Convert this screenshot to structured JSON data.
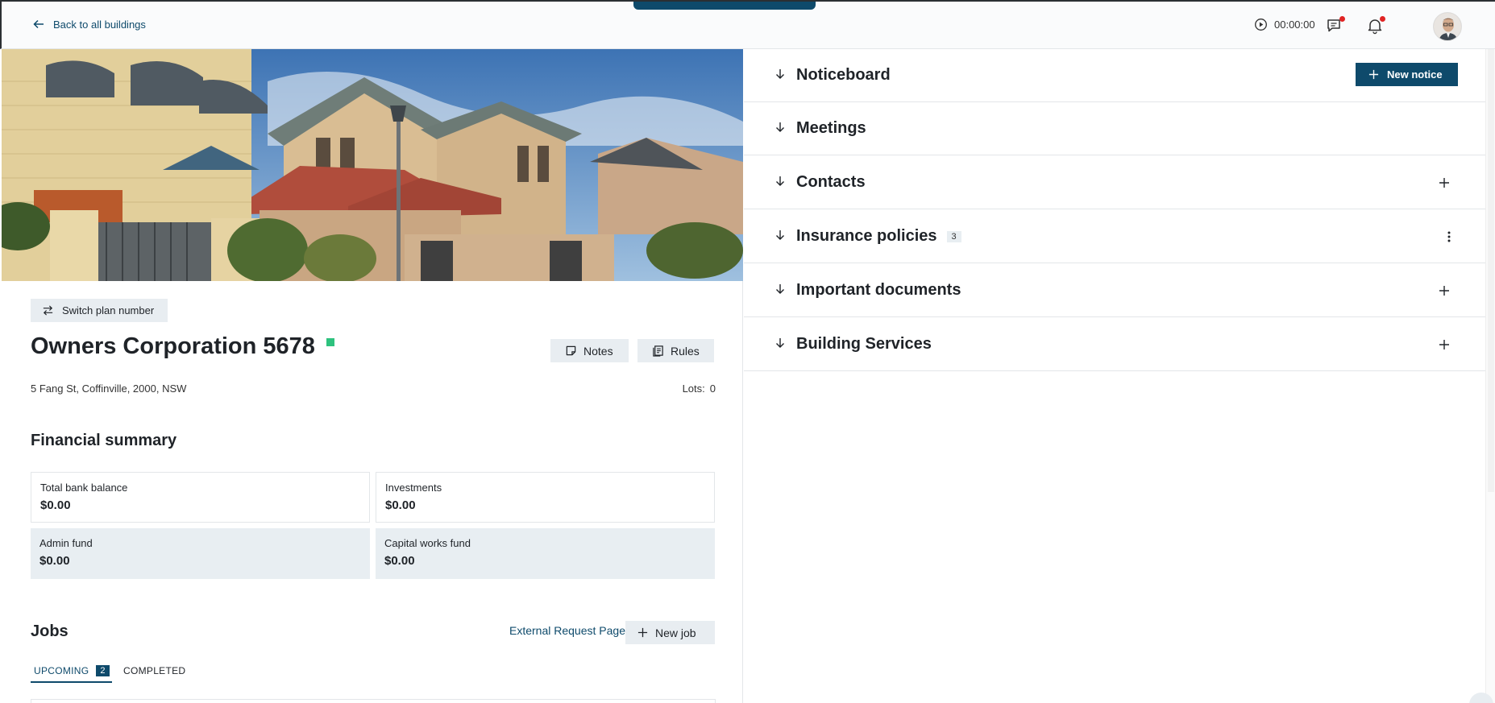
{
  "header": {
    "back_label": "Back to all buildings",
    "timer": "00:00:00"
  },
  "building": {
    "switch_label": "Switch plan number",
    "title": "Owners Corporation 5678",
    "notes_label": "Notes",
    "rules_label": "Rules",
    "address": "5 Fang St, Coffinville, 2000, NSW",
    "lots_label": "Lots:",
    "lots_value": "0"
  },
  "financial": {
    "title": "Financial summary",
    "cards": [
      {
        "label": "Total bank balance",
        "value": "$0.00"
      },
      {
        "label": "Investments",
        "value": "$0.00"
      },
      {
        "label": "Admin fund",
        "value": "$0.00"
      },
      {
        "label": "Capital works fund",
        "value": "$0.00"
      }
    ]
  },
  "jobs": {
    "title": "Jobs",
    "external_link": "External Request Page",
    "new_job_label": "New job",
    "tabs": [
      {
        "label": "UPCOMING",
        "count": "2"
      },
      {
        "label": "COMPLETED"
      }
    ]
  },
  "sections": [
    {
      "title": "Noticeboard",
      "action": "New notice"
    },
    {
      "title": "Meetings"
    },
    {
      "title": "Contacts"
    },
    {
      "title": "Insurance policies",
      "count": "3"
    },
    {
      "title": "Important documents"
    },
    {
      "title": "Building Services"
    }
  ],
  "colors": {
    "primary": "#0e4a6b",
    "status": "#2ec27e",
    "notification": "#e02424",
    "card_fill": "#e8eef2"
  }
}
